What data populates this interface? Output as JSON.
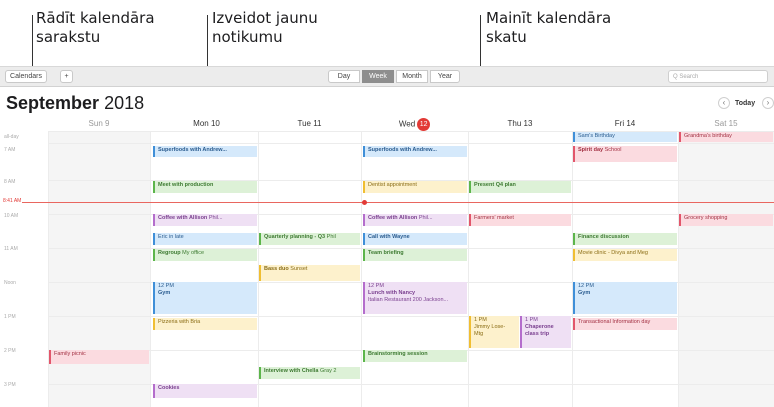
{
  "callouts": [
    {
      "line1": "Rādīt kalendāra",
      "line2": "sarakstu"
    },
    {
      "line1": "Izveidot jaunu",
      "line2": "notikumu"
    },
    {
      "line1": "Mainīt kalendāra",
      "line2": "skatu"
    }
  ],
  "toolbar": {
    "calendars_label": "Calendars",
    "add_label": "+",
    "views": [
      "Day",
      "Week",
      "Month",
      "Year"
    ],
    "active_view": "Week",
    "search_placeholder": "Q Search"
  },
  "header": {
    "month": "September",
    "year": "2018",
    "today_label": "Today",
    "prev": "‹",
    "next": "›"
  },
  "days": [
    {
      "label": "Sun 9",
      "weekend": true
    },
    {
      "label": "Mon 10",
      "weekend": false
    },
    {
      "label": "Tue 11",
      "weekend": false
    },
    {
      "label": "Wed",
      "badge": "12",
      "weekend": false
    },
    {
      "label": "Thu 13",
      "weekend": false
    },
    {
      "label": "Fri 14",
      "weekend": false
    },
    {
      "label": "Sat 15",
      "weekend": true
    }
  ],
  "time_labels": {
    "all_day": "all-day",
    "now": "8:41 AM",
    "hours": [
      "7 AM",
      "8 AM",
      "10 AM",
      "11 AM",
      "Noon",
      "1 PM",
      "2 PM",
      "3 PM"
    ]
  },
  "events": {
    "sams_birthday": "Sam's Birthday",
    "gramma_bday": "Grandma's birthday",
    "spirit_day": "Spirit day",
    "spirit_day_loc": "School",
    "superfoods_mon": "Superfoods with Andrew...",
    "superfoods_wed": "Superfoods with Andrew...",
    "meet_production": "Meet with production",
    "dentist": "Dentist appointment",
    "present_q4": "Present Q4 plan",
    "coffee_mon": "Coffee with Allison",
    "coffee_mon_loc": "Phil...",
    "coffee_wed": "Coffee with Allison",
    "coffee_wed_loc": "Phil...",
    "farmers_market": "Farmers' market",
    "grocery": "Grocery shopping",
    "eric_late": "Eric in late",
    "quarterly": "Quarterly planning - Q3",
    "quarterly_loc": "Phil",
    "call_wayne": "Call with Wayne",
    "finance": "Finance discussion",
    "regroup": "Regroup",
    "regroup_loc": "My office",
    "team_briefing": "Team briefing",
    "movie_clinic": "Movie clinic - Divya and Meg",
    "bass_duo": "Bass duo",
    "bass_duo_loc": "Sunset",
    "gym_mon_time": "12 PM",
    "gym_mon": "Gym",
    "lunch_time": "12 PM",
    "lunch": "Lunch with Nancy",
    "lunch_loc": "Italian Restaurant 200 Jackson...",
    "gym_fri_time": "12 PM",
    "gym_fri": "Gym",
    "pizza_mon": "Pizzeria with Bria",
    "jimmy_time": "1 PM",
    "jimmy": "Jimmy Lose-",
    "jimmy_loc": "Mtg",
    "chaperone_time": "1 PM",
    "chaperone": "Chaperone class trip",
    "transactional": "Transactional Information day",
    "family_picnic": "Family picnic",
    "brainstorm": "Brainstorming session",
    "interview": "Interview with Chella",
    "interview_loc": "Gray 2",
    "cookies": "Cookies"
  }
}
